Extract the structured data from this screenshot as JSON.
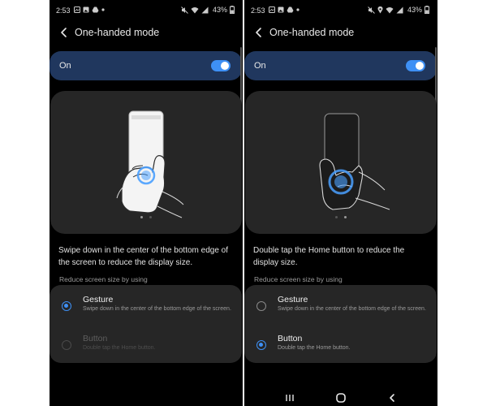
{
  "colors": {
    "accent": "#3e90f5",
    "toggle_bar": "#20375e",
    "card": "#262626",
    "background": "#000000"
  },
  "left_screen": {
    "status_bar": {
      "time": "2:53",
      "battery": "43%",
      "left_icons": [
        "gallery-icon",
        "image-icon",
        "drive-icon",
        "dot-icon"
      ],
      "right_icons": [
        "mute-icon",
        "wifi-icon",
        "signal-icon"
      ]
    },
    "header": {
      "title": "One-handed mode"
    },
    "toggle": {
      "label": "On",
      "state": "on"
    },
    "illustration": {
      "gesture": "swipe down from bottom edge",
      "page_indicator": {
        "count": 2,
        "active": 1
      }
    },
    "description": "Swipe down in the center of the bottom edge of the screen to reduce the display size.",
    "section_label": "Reduce screen size by using",
    "options": [
      {
        "title": "Gesture",
        "subtitle": "Swipe down in the center of the bottom edge of the screen.",
        "selected": true,
        "enabled": true
      },
      {
        "title": "Button",
        "subtitle": "Double tap the Home button.",
        "selected": false,
        "enabled": false
      }
    ]
  },
  "right_screen": {
    "status_bar": {
      "time": "2:53",
      "battery": "43%",
      "left_icons": [
        "gallery-icon",
        "image-icon",
        "drive-icon",
        "dot-icon"
      ],
      "right_icons": [
        "mute-icon",
        "location-icon",
        "wifi-icon",
        "signal-icon"
      ]
    },
    "header": {
      "title": "One-handed mode"
    },
    "toggle": {
      "label": "On",
      "state": "on"
    },
    "illustration": {
      "gesture": "double tap home button",
      "page_indicator": {
        "count": 2,
        "active": 2
      }
    },
    "description": "Double tap the Home button to reduce the display size.",
    "section_label": "Reduce screen size by using",
    "options": [
      {
        "title": "Gesture",
        "subtitle": "Swipe down in the center of the bottom edge of the screen.",
        "selected": false,
        "enabled": true
      },
      {
        "title": "Button",
        "subtitle": "Double tap the Home button.",
        "selected": true,
        "enabled": true
      }
    ],
    "navigation_bar": [
      "recents-icon",
      "home-icon",
      "back-nav-icon"
    ]
  }
}
